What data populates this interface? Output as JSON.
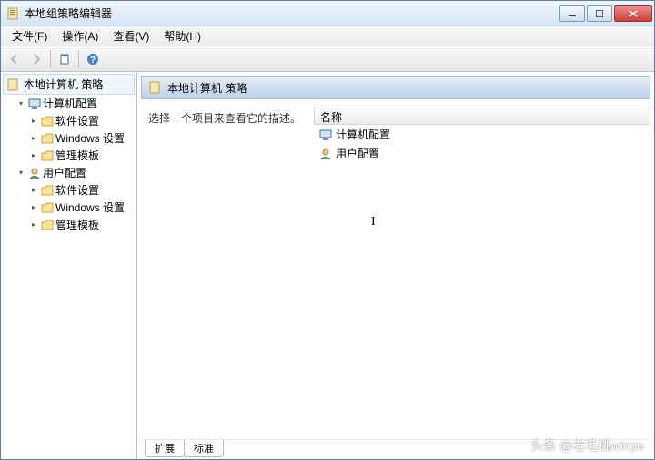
{
  "window": {
    "title": "本地组策略编辑器"
  },
  "menu": {
    "file": "文件(F)",
    "action": "操作(A)",
    "view": "查看(V)",
    "help": "帮助(H)"
  },
  "tree": {
    "root": "本地计算机 策略",
    "comp_config": "计算机配置",
    "user_config": "用户配置",
    "software_settings": "软件设置",
    "windows_settings": "Windows 设置",
    "admin_templates": "管理模板"
  },
  "content": {
    "header": "本地计算机 策略",
    "description": "选择一个项目来查看它的描述。",
    "name_col": "名称",
    "items": {
      "computer": "计算机配置",
      "user": "用户配置"
    }
  },
  "tabs": {
    "extended": "扩展",
    "standard": "标准"
  },
  "watermark": "头条 @老毛桃winpe"
}
